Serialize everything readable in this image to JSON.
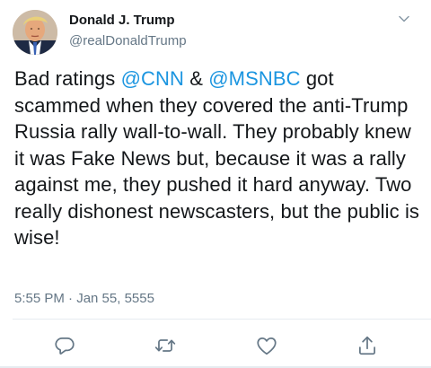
{
  "author": {
    "name": "Donald J. Trump",
    "handle": "@realDonaldTrump"
  },
  "tweet": {
    "segments": [
      {
        "text": "Bad ratings ",
        "type": "text"
      },
      {
        "text": "@CNN",
        "type": "mention"
      },
      {
        "text": " & ",
        "type": "text"
      },
      {
        "text": "@MSNBC",
        "type": "mention"
      },
      {
        "text": " got scammed when they covered the anti-Trump Russia rally wall-to-wall. They probably knew it was Fake News but, because it was a rally against me, they pushed it hard anyway. Two really dishonest newscasters, but the public is wise!",
        "type": "text"
      }
    ]
  },
  "timestamp": "5:55 PM · Jan 55, 5555",
  "icons": {
    "menu": "chevron-down-icon",
    "reply": "reply-icon",
    "retweet": "retweet-icon",
    "like": "heart-icon",
    "share": "share-icon"
  },
  "colors": {
    "accent": "#1b95e0",
    "muted": "#657786",
    "text": "#14171a",
    "divider": "#e6ecf0"
  }
}
